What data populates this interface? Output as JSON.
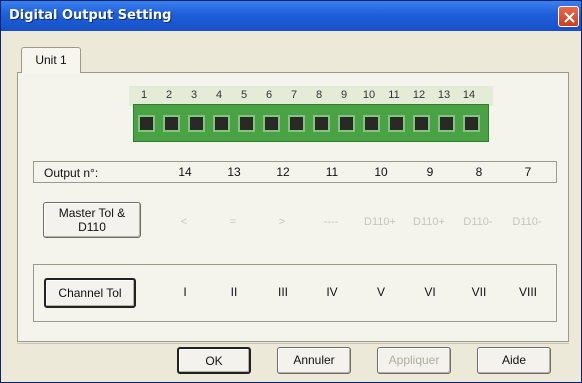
{
  "window": {
    "title": "Digital Output Setting",
    "close_icon": "close-icon"
  },
  "tabs": [
    {
      "label": "Unit 1",
      "selected": true
    }
  ],
  "terminal": {
    "numbers": [
      "1",
      "2",
      "3",
      "4",
      "5",
      "6",
      "7",
      "8",
      "9",
      "10",
      "11",
      "12",
      "13",
      "14"
    ],
    "color": "#49a345"
  },
  "output_row": {
    "label": "Output n°:",
    "values": [
      "14",
      "13",
      "12",
      "11",
      "10",
      "9",
      "8",
      "7"
    ]
  },
  "master_row": {
    "button_label": "Master Tol &\nD110",
    "values": [
      "<",
      "=",
      ">",
      "----",
      "D110+",
      "D110+",
      "D110-",
      "D110-"
    ]
  },
  "channel_row": {
    "button_label": "Channel Tol",
    "values": [
      "I",
      "II",
      "III",
      "IV",
      "V",
      "VI",
      "VII",
      "VIII"
    ]
  },
  "dialog_buttons": {
    "ok": "OK",
    "cancel": "Annuler",
    "apply": "Appliquer",
    "help": "Aide"
  }
}
